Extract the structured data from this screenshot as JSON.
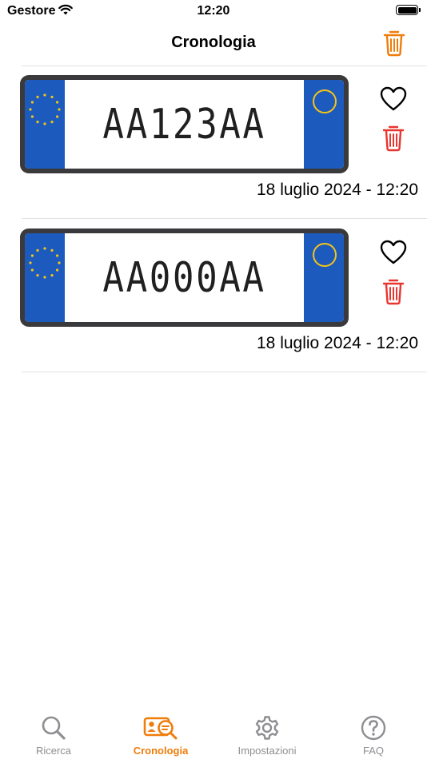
{
  "status_bar": {
    "carrier": "Gestore",
    "time": "12:20"
  },
  "nav": {
    "title": "Cronologia",
    "trash_icon": "trash-icon"
  },
  "entries": [
    {
      "plate": "AA123AA",
      "date": "18 luglio 2024 - 12:20"
    },
    {
      "plate": "AA000AA",
      "date": "18 luglio 2024 - 12:20"
    }
  ],
  "tabs": [
    {
      "label": "Ricerca",
      "icon": "search-icon",
      "active": false
    },
    {
      "label": "Cronologia",
      "icon": "history-icon",
      "active": true
    },
    {
      "label": "Impostazioni",
      "icon": "gear-icon",
      "active": false
    },
    {
      "label": "FAQ",
      "icon": "question-icon",
      "active": false
    }
  ],
  "colors": {
    "accent": "#ef7d0b",
    "delete": "#e8352f",
    "plate_blue": "#1c5bbd",
    "plate_yellow": "#f6c415",
    "plate_frame": "#3a3a3c",
    "tab_inactive": "#8e8e93"
  }
}
